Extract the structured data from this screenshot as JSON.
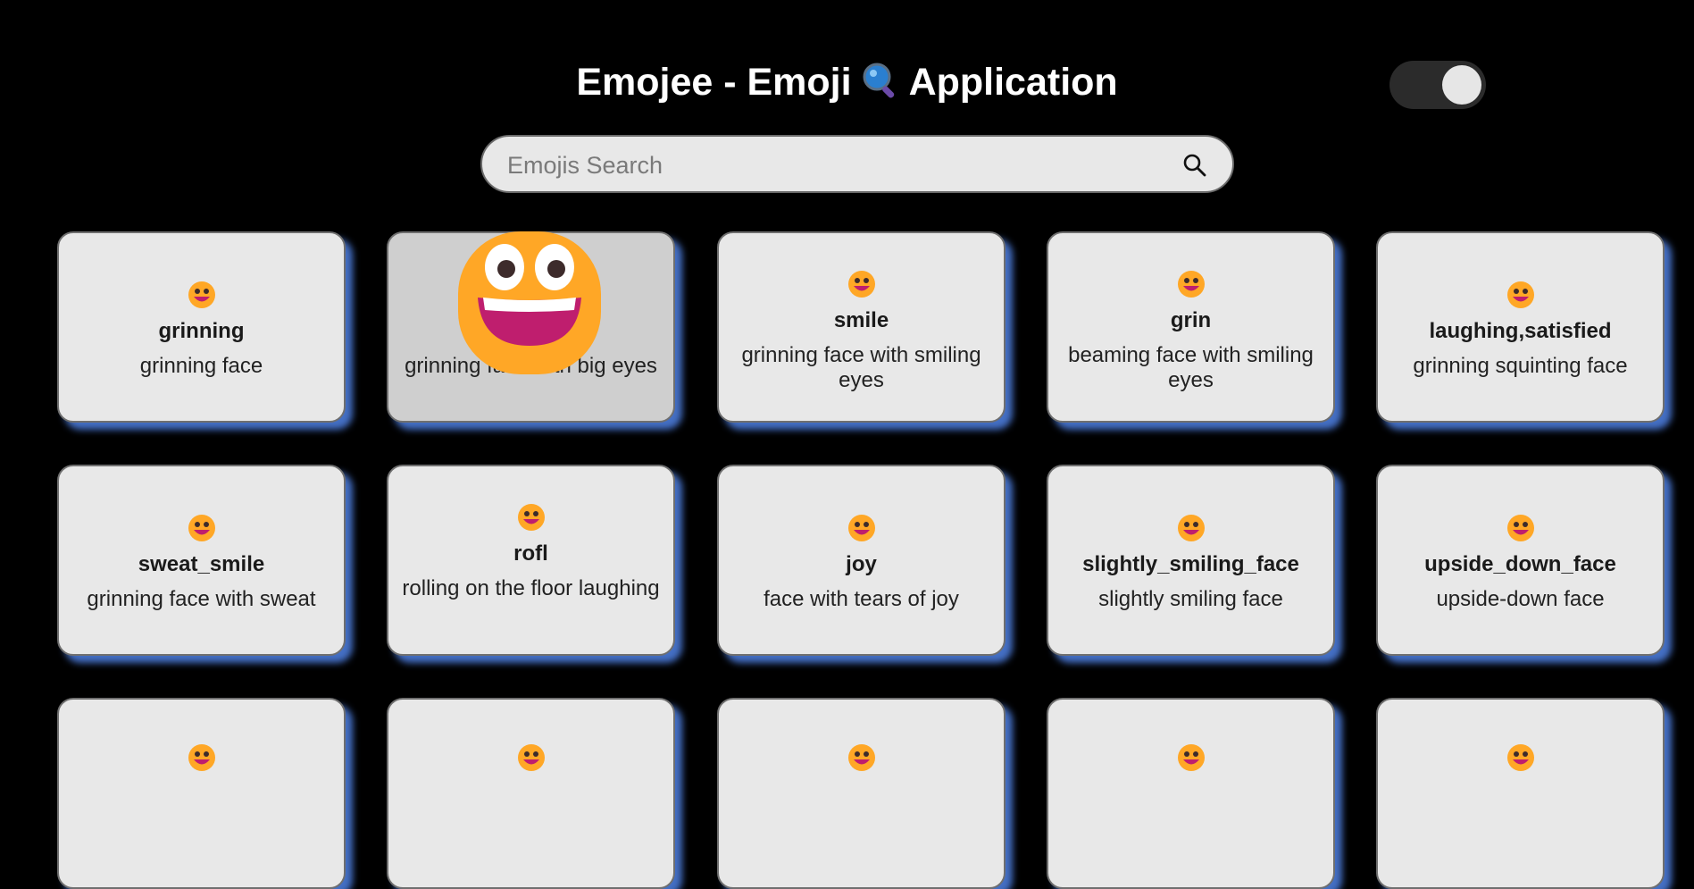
{
  "header": {
    "title_left": "Emojee - Emoji",
    "title_right": "Application",
    "title_icon": "magnifying-glass-icon"
  },
  "theme_toggle": {
    "state": "on"
  },
  "search": {
    "placeholder": "Emojis Search",
    "value": "",
    "icon": "search-icon"
  },
  "colors": {
    "background": "#000000",
    "card_bg": "#e8e8e8",
    "card_hover_bg": "#cfcfcf",
    "card_shadow": "#5082e6",
    "emoji_face": "#ffa726",
    "emoji_mouth": "#bf1e6e"
  },
  "cards": [
    {
      "name": "grinning",
      "desc": "grinning face",
      "icon": "grinning-face-icon"
    },
    {
      "name": "",
      "desc": "grinning face with big eyes",
      "icon": "grinning-face-with-big-eyes-icon"
    },
    {
      "name": "smile",
      "desc": "grinning face with smiling eyes",
      "icon": "grinning-face-with-smiling-eyes-icon"
    },
    {
      "name": "grin",
      "desc": "beaming face with smiling eyes",
      "icon": "beaming-face-icon"
    },
    {
      "name": "laughing,satisfied",
      "desc": "grinning squinting face",
      "icon": "grinning-squinting-face-icon"
    },
    {
      "name": "sweat_smile",
      "desc": "grinning face with sweat",
      "icon": "grinning-face-with-sweat-icon"
    },
    {
      "name": "rofl",
      "desc": "rolling on the floor laughing",
      "icon": "rofl-icon"
    },
    {
      "name": "joy",
      "desc": "face with tears of joy",
      "icon": "tears-of-joy-icon"
    },
    {
      "name": "slightly_smiling_face",
      "desc": "slightly smiling face",
      "icon": "slightly-smiling-face-icon"
    },
    {
      "name": "upside_down_face",
      "desc": "upside-down face",
      "icon": "upside-down-face-icon"
    },
    {
      "name": "",
      "desc": "",
      "icon": "winking-face-icon"
    },
    {
      "name": "",
      "desc": "",
      "icon": "smiling-face-icon"
    },
    {
      "name": "",
      "desc": "",
      "icon": "smiling-face-with-halo-icon"
    },
    {
      "name": "",
      "desc": "",
      "icon": "smiling-face-with-hearts-icon"
    },
    {
      "name": "",
      "desc": "",
      "icon": "heart-eyes-icon"
    }
  ]
}
